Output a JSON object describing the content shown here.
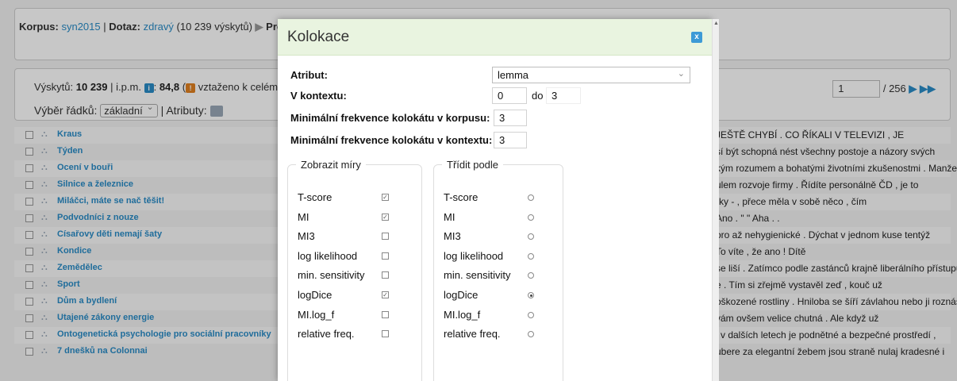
{
  "background": {
    "crumb": {
      "korpus_label": "Korpus:",
      "korpus_value": "syn2015",
      "separator": "|",
      "dotaz_label": "Dotaz:",
      "dotaz_value": "zdravý",
      "count": "(10 239 výskytů)",
      "arrow": "▶",
      "tail": "Promí"
    },
    "stats": {
      "vyskytu_label": "Výskytů:",
      "vyskytu_value": "10 239",
      "separator": "|",
      "ipm_label": "i.p.m.",
      "ipm_value": "84,8",
      "relative_text": "vztaženo k celému \"syn"
    },
    "lines": {
      "label": "Výběr řádků:",
      "select_value": "základní",
      "separator": "|",
      "attrs_label": "Atributy:"
    },
    "pager": {
      "page": "1",
      "total": "/ 256",
      "next": "▶ ▶▶"
    },
    "rows": [
      {
        "source": "Kraus",
        "context": "JEŠTĚ CHYBÍ . CO ŘÍKALI V TELEVIZI , JE"
      },
      {
        "source": "Týden",
        "context": "sí být schopná nést všechny postoje a názory svých"
      },
      {
        "source": "Ocení v bouři",
        "context": "kým rozumem a bohatými životními zkušenostmi . Manžel je"
      },
      {
        "source": "Silnice a železnice",
        "context": "ulem rozvoje firmy . Řídíte personálně ČD , je to"
      },
      {
        "source": "Miláčci, máte se nač těšit!",
        "context": "rky - , přece měla v sobě něco , čím"
      },
      {
        "source": "Podvodníci z nouze",
        "context": "Ano . \" \" Aha . ."
      },
      {
        "source": "Císařovy děti nemají šaty",
        "context": "oro až nehygienické . Dýchat v jednom kuse tentýž"
      },
      {
        "source": "Kondice",
        "context": "To víte , že ano ! Dítě"
      },
      {
        "source": "Zemědělec",
        "context": "se liší . Zatímco podle zastánců krajně liberálního přístupu"
      },
      {
        "source": "Sport",
        "context": "e . Tím si zřejmě vystavěl zeď , kouč už"
      },
      {
        "source": "Dům a bydlení",
        "context": "oškozené rostliny . Hniloba se šíří závlahou nebo ji roznáší"
      },
      {
        "source": "Utajené zákony energie",
        "context": "vám ovšem velice chutná . Ale když už"
      },
      {
        "source": "Ontogenetická psychologie pro sociální pracovníky",
        "context": "j v dalších letech je podnětné a bezpečné prostředí ,"
      },
      {
        "source": "7 dnešků na Colonnai",
        "context": "ubere za elegantní žebem jsou straně nulaj kradesné i"
      }
    ]
  },
  "modal": {
    "title": "Kolokace",
    "close": "x",
    "atribut_label": "Atribut:",
    "atribut_value": "lemma",
    "context_label": "V kontextu:",
    "context_from": "0",
    "context_to_label": "do",
    "context_to": "3",
    "min_freq_corpus_label": "Minimální frekvence kolokátu v korpusu:",
    "min_freq_corpus": "3",
    "min_freq_context_label": "Minimální frekvence kolokátu v kontextu:",
    "min_freq_context": "3",
    "show_legend": "Zobrazit míry",
    "sort_legend": "Třídit podle",
    "measures": [
      {
        "name": "T-score",
        "shown": true,
        "sort": false
      },
      {
        "name": "MI",
        "shown": true,
        "sort": false
      },
      {
        "name": "MI3",
        "shown": false,
        "sort": false
      },
      {
        "name": "log likelihood",
        "shown": false,
        "sort": false
      },
      {
        "name": "min. sensitivity",
        "shown": false,
        "sort": false
      },
      {
        "name": "logDice",
        "shown": true,
        "sort": true
      },
      {
        "name": "MI.log_f",
        "shown": false,
        "sort": false
      },
      {
        "name": "relative freq.",
        "shown": false,
        "sort": false
      }
    ]
  }
}
